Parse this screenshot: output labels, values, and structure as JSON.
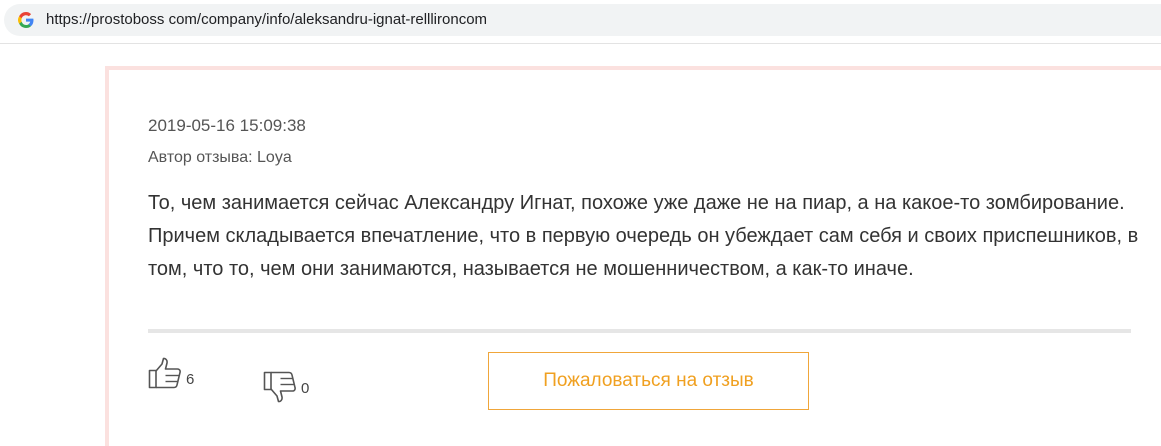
{
  "browser": {
    "url": "https://prostoboss com/company/info/aleksandru-ignat-relllironcom",
    "favicon": "google-g-icon"
  },
  "review": {
    "timestamp": "2019-05-16 15:09:38",
    "author": "Автор отзыва: Loya",
    "text": "То, чем занимается сейчас Александру Игнат, похоже уже даже не на пиар, а на какое-то зомбирование. Причем складывается впечатление, что в первую очередь он убеждает сам себя и своих приспешников, в том, что то, чем они занимаются, называется не мошенничеством, а как-то иначе.",
    "likes": "6",
    "dislikes": "0",
    "complain_label": "Пожаловаться на отзыв"
  },
  "colors": {
    "card_border": "#fbe1df",
    "accent": "#f0a020",
    "text": "#333333"
  }
}
